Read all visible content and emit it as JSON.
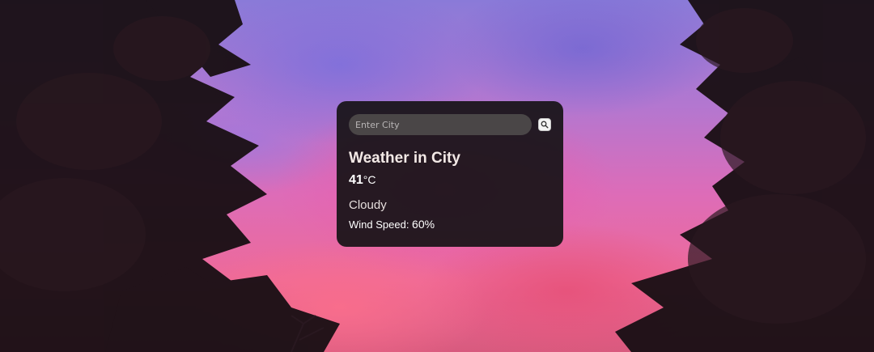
{
  "search": {
    "placeholder": "Enter City",
    "value": "",
    "button_icon": "search-icon"
  },
  "weather": {
    "title": "Weather in City",
    "temperature": "41",
    "unit": "°C",
    "condition": "Cloudy",
    "wind_label": "Wind Speed: ",
    "wind_value": "60%"
  },
  "colors": {
    "card_background": "#161216",
    "input_background": "#4a4647",
    "title_text": "#f3e9e6",
    "sky_pink": "#ee6a98",
    "sky_purple": "#8a7ad8"
  }
}
